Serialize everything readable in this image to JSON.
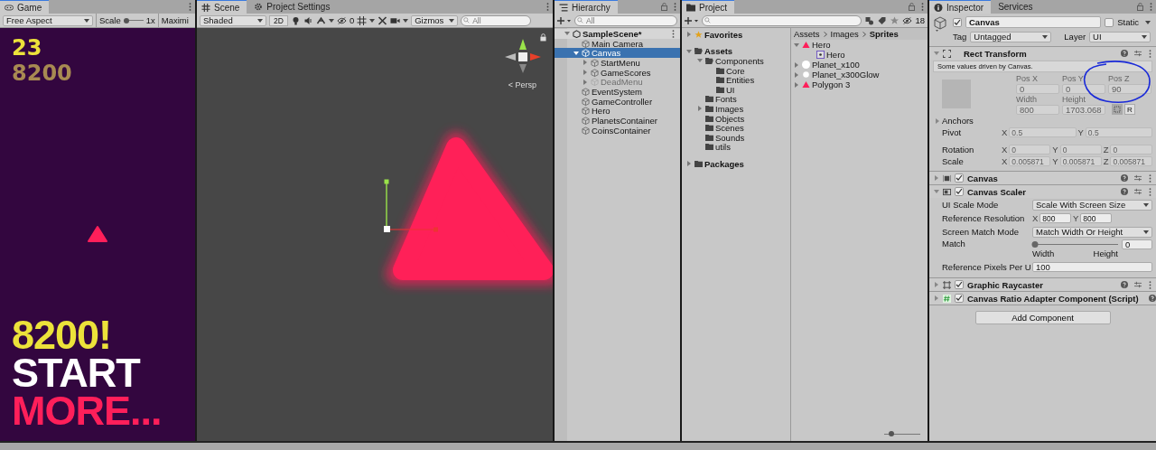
{
  "game": {
    "tab": "Game",
    "aspect": "Free Aspect",
    "scale_label": "Scale",
    "scale_slider": {
      "level": 0
    },
    "scale_value": "1x",
    "maximize": "Maximi",
    "score": "23",
    "coins": "8200",
    "hud": [
      {
        "text": "8200!",
        "color": "#ece23a"
      },
      {
        "text": "START",
        "color": "#ffffff"
      },
      {
        "text": "MORE...",
        "color": "#ff1f5a"
      }
    ]
  },
  "scene": {
    "tabs": [
      {
        "label": "Scene",
        "selected": true
      },
      {
        "label": "Project Settings",
        "selected": false
      }
    ],
    "shading": "Shaded",
    "mode_2d": "2D",
    "hidden_count": "0",
    "gizmos": "Gizmos",
    "search_placeholder": "All",
    "projection": "< Persp"
  },
  "hierarchy": {
    "tab": "Hierarchy",
    "search_placeholder": "All",
    "items": [
      {
        "label": "SampleScene*",
        "kind": "scene",
        "expanded": true,
        "selected": false,
        "disabled": false,
        "children": [
          {
            "label": "Main Camera",
            "kind": "object",
            "selected": false,
            "disabled": false
          },
          {
            "label": "Canvas",
            "kind": "object",
            "expanded": true,
            "selected": true,
            "disabled": false,
            "children": [
              {
                "label": "StartMenu",
                "kind": "object",
                "expanded": false,
                "selected": false,
                "disabled": false
              },
              {
                "label": "GameScores",
                "kind": "object",
                "expanded": false,
                "selected": false,
                "disabled": false
              },
              {
                "label": "DeadMenu",
                "kind": "object",
                "expanded": false,
                "selected": false,
                "disabled": true
              }
            ]
          },
          {
            "label": "EventSystem",
            "kind": "object",
            "selected": false,
            "disabled": false
          },
          {
            "label": "GameController",
            "kind": "object",
            "selected": false,
            "disabled": false
          },
          {
            "label": "Hero",
            "kind": "object",
            "selected": false,
            "disabled": false
          },
          {
            "label": "PlanetsContainer",
            "kind": "object",
            "selected": false,
            "disabled": false
          },
          {
            "label": "CoinsContainer",
            "kind": "object",
            "selected": false,
            "disabled": false
          }
        ]
      }
    ]
  },
  "project": {
    "tab": "Project",
    "hidden_count": "18",
    "tree": [
      {
        "label": "Favorites",
        "kind": "favorites",
        "expanded": false
      },
      {
        "label": "Assets",
        "kind": "folder",
        "expanded": true,
        "children": [
          {
            "label": "Components",
            "kind": "folder",
            "expanded": true,
            "children": [
              {
                "label": "Core",
                "kind": "folder"
              },
              {
                "label": "Entities",
                "kind": "folder"
              },
              {
                "label": "UI",
                "kind": "folder"
              }
            ]
          },
          {
            "label": "Fonts",
            "kind": "folder"
          },
          {
            "label": "Images",
            "kind": "folder",
            "expanded": false
          },
          {
            "label": "Objects",
            "kind": "folder"
          },
          {
            "label": "Scenes",
            "kind": "folder"
          },
          {
            "label": "Sounds",
            "kind": "folder"
          },
          {
            "label": "utils",
            "kind": "folder"
          }
        ]
      },
      {
        "label": "Packages",
        "kind": "folder",
        "expanded": false
      }
    ],
    "breadcrumb": [
      "Assets",
      "Images",
      "Sprites"
    ],
    "assets": [
      {
        "label": "Hero",
        "kind": "triangle",
        "expanded": true,
        "children": [
          {
            "label": "Hero",
            "kind": "sprite"
          }
        ]
      },
      {
        "label": "Planet_x100",
        "kind": "circle",
        "expanded": false
      },
      {
        "label": "Planet_x300Glow",
        "kind": "dot",
        "expanded": false
      },
      {
        "label": "Polygon 3",
        "kind": "triangle",
        "expanded": false
      }
    ],
    "zoom_slider": {
      "level": 0.15
    }
  },
  "inspector": {
    "tabs": [
      {
        "label": "Inspector",
        "selected": true
      },
      {
        "label": "Services",
        "selected": false
      }
    ],
    "object": {
      "active": true,
      "name": "Canvas",
      "static": false,
      "static_label": "Static",
      "tag_label": "Tag",
      "tag": "Untagged",
      "layer_label": "Layer",
      "layer": "UI"
    },
    "components": [
      {
        "kind": "rect",
        "title": "Rect Transform",
        "expanded": true,
        "note": "Some values driven by Canvas.",
        "pos": [
          {
            "label": "Pos X",
            "value": "0"
          },
          {
            "label": "Pos Y",
            "value": "0"
          },
          {
            "label": "Pos Z",
            "value": "90"
          }
        ],
        "size": [
          {
            "label": "Width",
            "value": "800"
          },
          {
            "label": "Height",
            "value": "1703.068"
          }
        ],
        "raw_button": "R",
        "anchors": {
          "label": "Anchors",
          "expanded": false
        },
        "vectors": [
          {
            "label": "Pivot",
            "axes": [
              {
                "axis": "X",
                "value": "0.5"
              },
              {
                "axis": "Y",
                "value": "0.5"
              }
            ]
          },
          {
            "label": "Rotation",
            "axes": [
              {
                "axis": "X",
                "value": "0"
              },
              {
                "axis": "Y",
                "value": "0"
              },
              {
                "axis": "Z",
                "value": "0"
              }
            ]
          },
          {
            "label": "Scale",
            "axes": [
              {
                "axis": "X",
                "value": "0.005871"
              },
              {
                "axis": "Y",
                "value": "0.005871"
              },
              {
                "axis": "Z",
                "value": "0.005871"
              }
            ]
          }
        ]
      },
      {
        "kind": "canvas",
        "title": "Canvas",
        "enabled": true,
        "expanded": false
      },
      {
        "kind": "scaler",
        "title": "Canvas Scaler",
        "enabled": true,
        "expanded": true,
        "rows": [
          {
            "kind": "dropdown",
            "label": "UI Scale Mode",
            "value": "Scale With Screen Size"
          },
          {
            "kind": "vector",
            "label": "Reference Resolution",
            "axes": [
              {
                "axis": "X",
                "value": "800"
              },
              {
                "axis": "Y",
                "value": "800"
              }
            ]
          },
          {
            "kind": "dropdown",
            "label": "Screen Match Mode",
            "value": "Match Width Or Height"
          },
          {
            "kind": "slider",
            "label": "Match",
            "level": 0,
            "value": "0",
            "min_label": "Width",
            "max_label": "Height"
          },
          {
            "kind": "number",
            "label": "Reference Pixels Per U",
            "value": "100"
          }
        ]
      },
      {
        "kind": "raycaster",
        "title": "Graphic Raycaster",
        "enabled": true,
        "expanded": false
      },
      {
        "kind": "script",
        "title": "Canvas Ratio Adapter Component (Script)",
        "enabled": true,
        "expanded": false
      }
    ],
    "add_button": "Add Component"
  }
}
